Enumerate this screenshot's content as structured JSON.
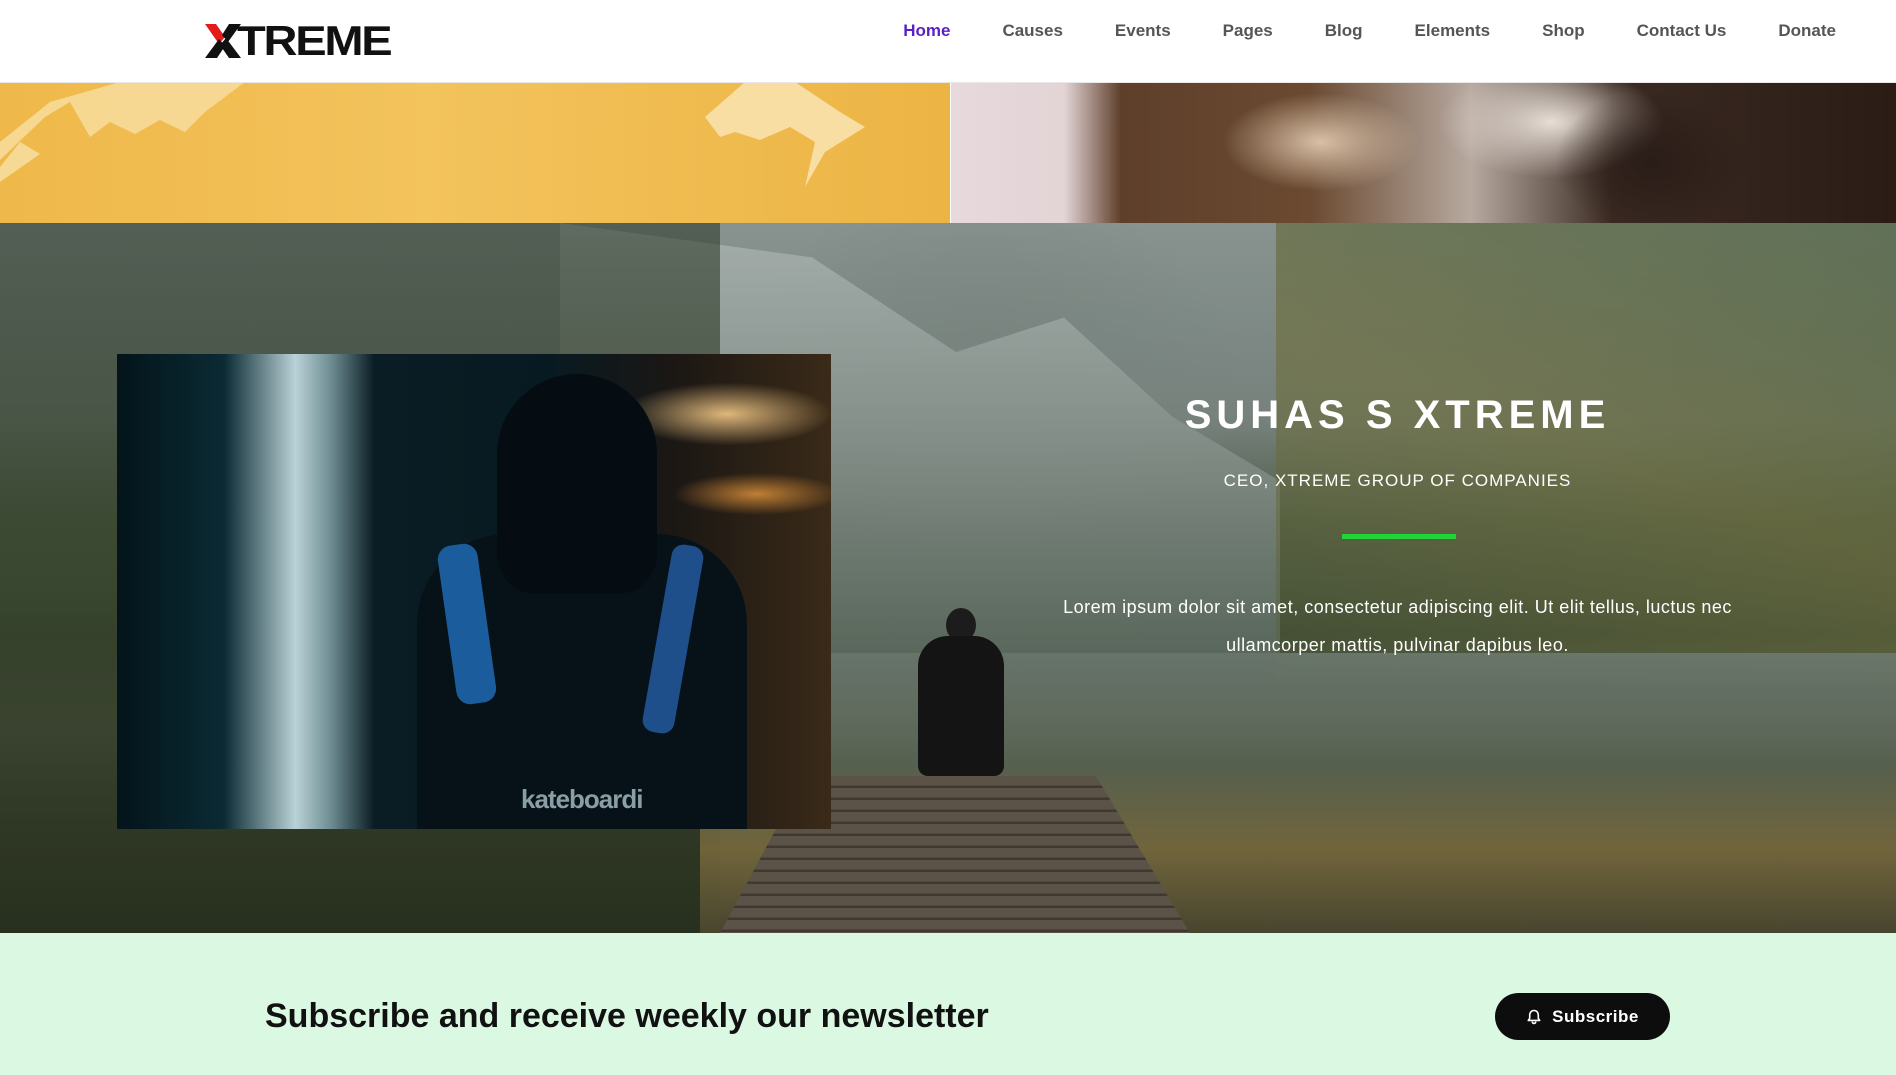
{
  "header": {
    "logo_text": "TREME",
    "nav": [
      {
        "label": "Home",
        "active": true
      },
      {
        "label": "Causes",
        "active": false
      },
      {
        "label": "Events",
        "active": false
      },
      {
        "label": "Pages",
        "active": false
      },
      {
        "label": "Blog",
        "active": false
      },
      {
        "label": "Elements",
        "active": false
      },
      {
        "label": "Shop",
        "active": false
      },
      {
        "label": "Contact Us",
        "active": false
      },
      {
        "label": "Donate",
        "active": false
      }
    ]
  },
  "hero": {
    "name": "SUHAS S XTREME",
    "title": "CEO, XTREME GROUP OF COMPANIES",
    "text": "Lorem ipsum dolor sit amet, consectetur adipiscing elit. Ut elit tellus, luctus nec ullamcorper mattis, pulvinar dapibus leo.",
    "inset_caption": "kateboardi",
    "accent_color": "#22d33a"
  },
  "newsletter": {
    "heading": "Subscribe and receive weekly our newsletter",
    "button_label": "Subscribe",
    "button_icon": "bell-icon"
  },
  "colors": {
    "nav_active": "#5a1fc9",
    "nav_default": "#555555",
    "strip_yellow": "#efb84a",
    "newsletter_bg": "#dbf8e2",
    "button_bg": "#0d0d0d"
  }
}
